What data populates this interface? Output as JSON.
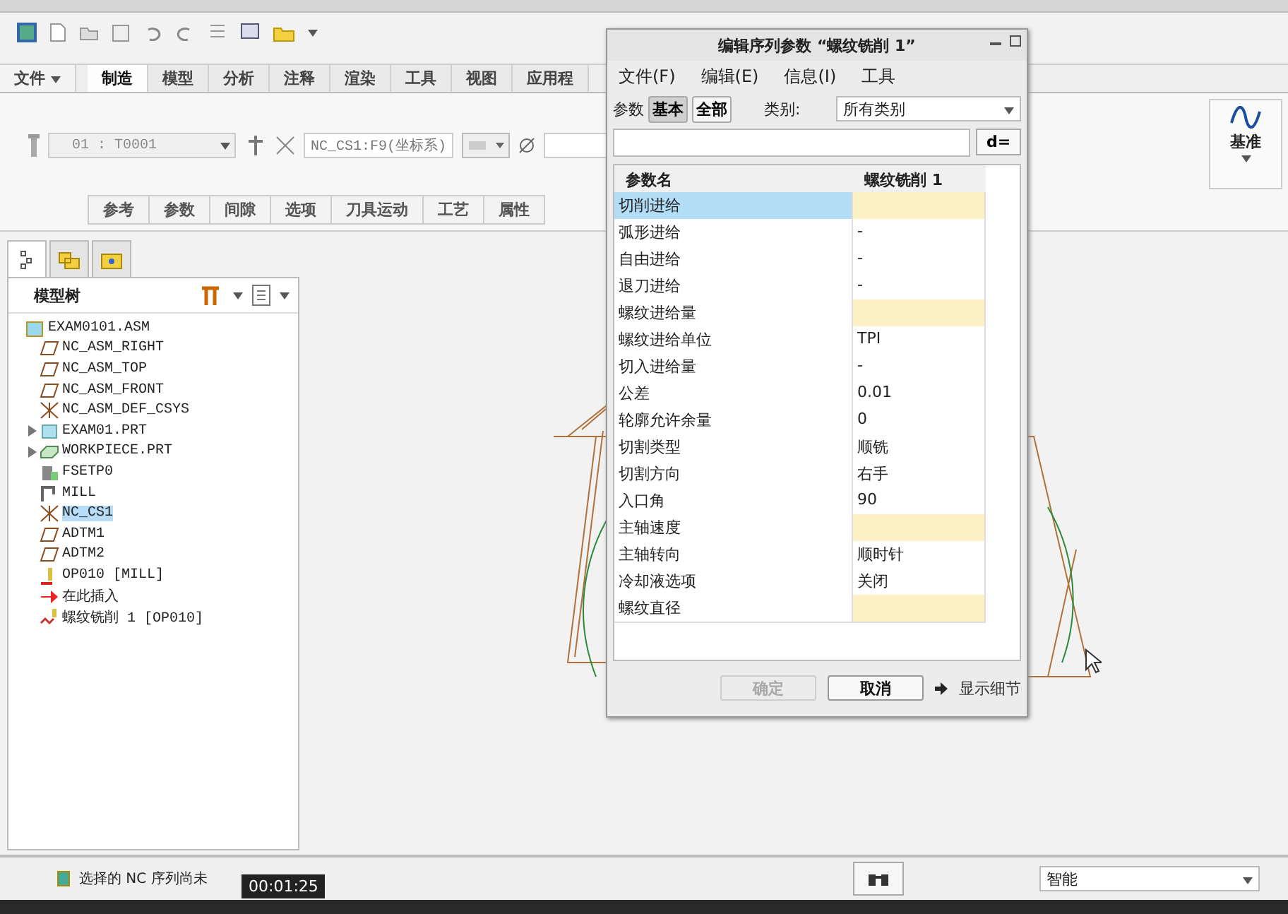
{
  "ribbon": {
    "menu_tabs": [
      {
        "label": "文件",
        "selected": false,
        "kind": "file"
      },
      {
        "label": "制造",
        "selected": true,
        "kind": "tab"
      },
      {
        "label": "模型",
        "selected": false,
        "kind": "tab"
      },
      {
        "label": "分析",
        "selected": false,
        "kind": "tab"
      },
      {
        "label": "注释",
        "selected": false,
        "kind": "tab"
      },
      {
        "label": "渲染",
        "selected": false,
        "kind": "tab"
      },
      {
        "label": "工具",
        "selected": false,
        "kind": "tab"
      },
      {
        "label": "视图",
        "selected": false,
        "kind": "tab"
      },
      {
        "label": "应用程",
        "selected": false,
        "kind": "tab"
      }
    ],
    "tool_select": "01 : T0001",
    "csys_field": "NC_CS1:F9(坐标系)",
    "sub_tabs": [
      "参考",
      "参数",
      "间隙",
      "选项",
      "刀具运动",
      "工艺",
      "属性"
    ],
    "datum_label": "基准"
  },
  "sidebar": {
    "title": "模型树",
    "tree": [
      {
        "label": "EXAM0101.ASM",
        "kind": "assembly",
        "selected": false,
        "children": [
          {
            "label": "NC_ASM_RIGHT",
            "kind": "plane",
            "selected": false
          },
          {
            "label": "NC_ASM_TOP",
            "kind": "plane",
            "selected": false
          },
          {
            "label": "NC_ASM_FRONT",
            "kind": "plane",
            "selected": false
          },
          {
            "label": "NC_ASM_DEF_CSYS",
            "kind": "csys",
            "selected": false
          },
          {
            "label": "EXAM01.PRT",
            "kind": "part",
            "selected": false,
            "expandable": true
          },
          {
            "label": "WORKPIECE.PRT",
            "kind": "workpiece",
            "selected": false,
            "expandable": true
          },
          {
            "label": "FSETP0",
            "kind": "fixture",
            "selected": false
          },
          {
            "label": "MILL",
            "kind": "mill",
            "selected": false
          },
          {
            "label": "NC_CS1",
            "kind": "csys",
            "selected": true
          },
          {
            "label": "ADTM1",
            "kind": "plane",
            "selected": false
          },
          {
            "label": "ADTM2",
            "kind": "plane",
            "selected": false
          },
          {
            "label": "OP010 [MILL]",
            "kind": "operation",
            "selected": false
          },
          {
            "label": "在此插入",
            "kind": "insert",
            "selected": false
          },
          {
            "label": "螺纹铣削 1 [OP010]",
            "kind": "sequence",
            "selected": false
          }
        ]
      }
    ]
  },
  "dialog": {
    "title": "编辑序列参数 “螺纹铣削 1”",
    "menu": [
      "文件(F)",
      "编辑(E)",
      "信息(I)",
      "工具"
    ],
    "params_label": "参数",
    "modes": [
      {
        "label": "基本",
        "selected": true
      },
      {
        "label": "全部",
        "selected": false
      }
    ],
    "category_label": "类别:",
    "category_value": "所有类别",
    "formula_button": "d=",
    "columns": [
      "参数名",
      "螺纹铣削 1"
    ],
    "rows": [
      {
        "name": "切削进给",
        "value": "",
        "required": true,
        "selected": true
      },
      {
        "name": "弧形进给",
        "value": "-",
        "required": false,
        "selected": false
      },
      {
        "name": "自由进给",
        "value": "-",
        "required": false,
        "selected": false
      },
      {
        "name": "退刀进给",
        "value": "-",
        "required": false,
        "selected": false
      },
      {
        "name": "螺纹进给量",
        "value": "",
        "required": true,
        "selected": false
      },
      {
        "name": "螺纹进给单位",
        "value": "TPI",
        "required": false,
        "selected": false
      },
      {
        "name": "切入进给量",
        "value": "-",
        "required": false,
        "selected": false
      },
      {
        "name": "公差",
        "value": "0.01",
        "required": false,
        "selected": false
      },
      {
        "name": "轮廓允许余量",
        "value": "0",
        "required": false,
        "selected": false
      },
      {
        "name": "切割类型",
        "value": "顺铣",
        "required": false,
        "selected": false
      },
      {
        "name": "切割方向",
        "value": "右手",
        "required": false,
        "selected": false
      },
      {
        "name": "入口角",
        "value": "90",
        "required": false,
        "selected": false
      },
      {
        "name": "主轴速度",
        "value": "",
        "required": true,
        "selected": false
      },
      {
        "name": "主轴转向",
        "value": "顺时针",
        "required": false,
        "selected": false
      },
      {
        "name": "冷却液选项",
        "value": "关闭",
        "required": false,
        "selected": false
      },
      {
        "name": "螺纹直径",
        "value": "",
        "required": true,
        "selected": false
      }
    ],
    "ok_button": {
      "label": "确定",
      "disabled": true
    },
    "cancel_button": {
      "label": "取消",
      "disabled": false
    },
    "details_link": "显示细节"
  },
  "status_bar": {
    "message": "选择的 NC 序列尚未",
    "filter": "智能"
  },
  "video_time": "00:01:25"
}
